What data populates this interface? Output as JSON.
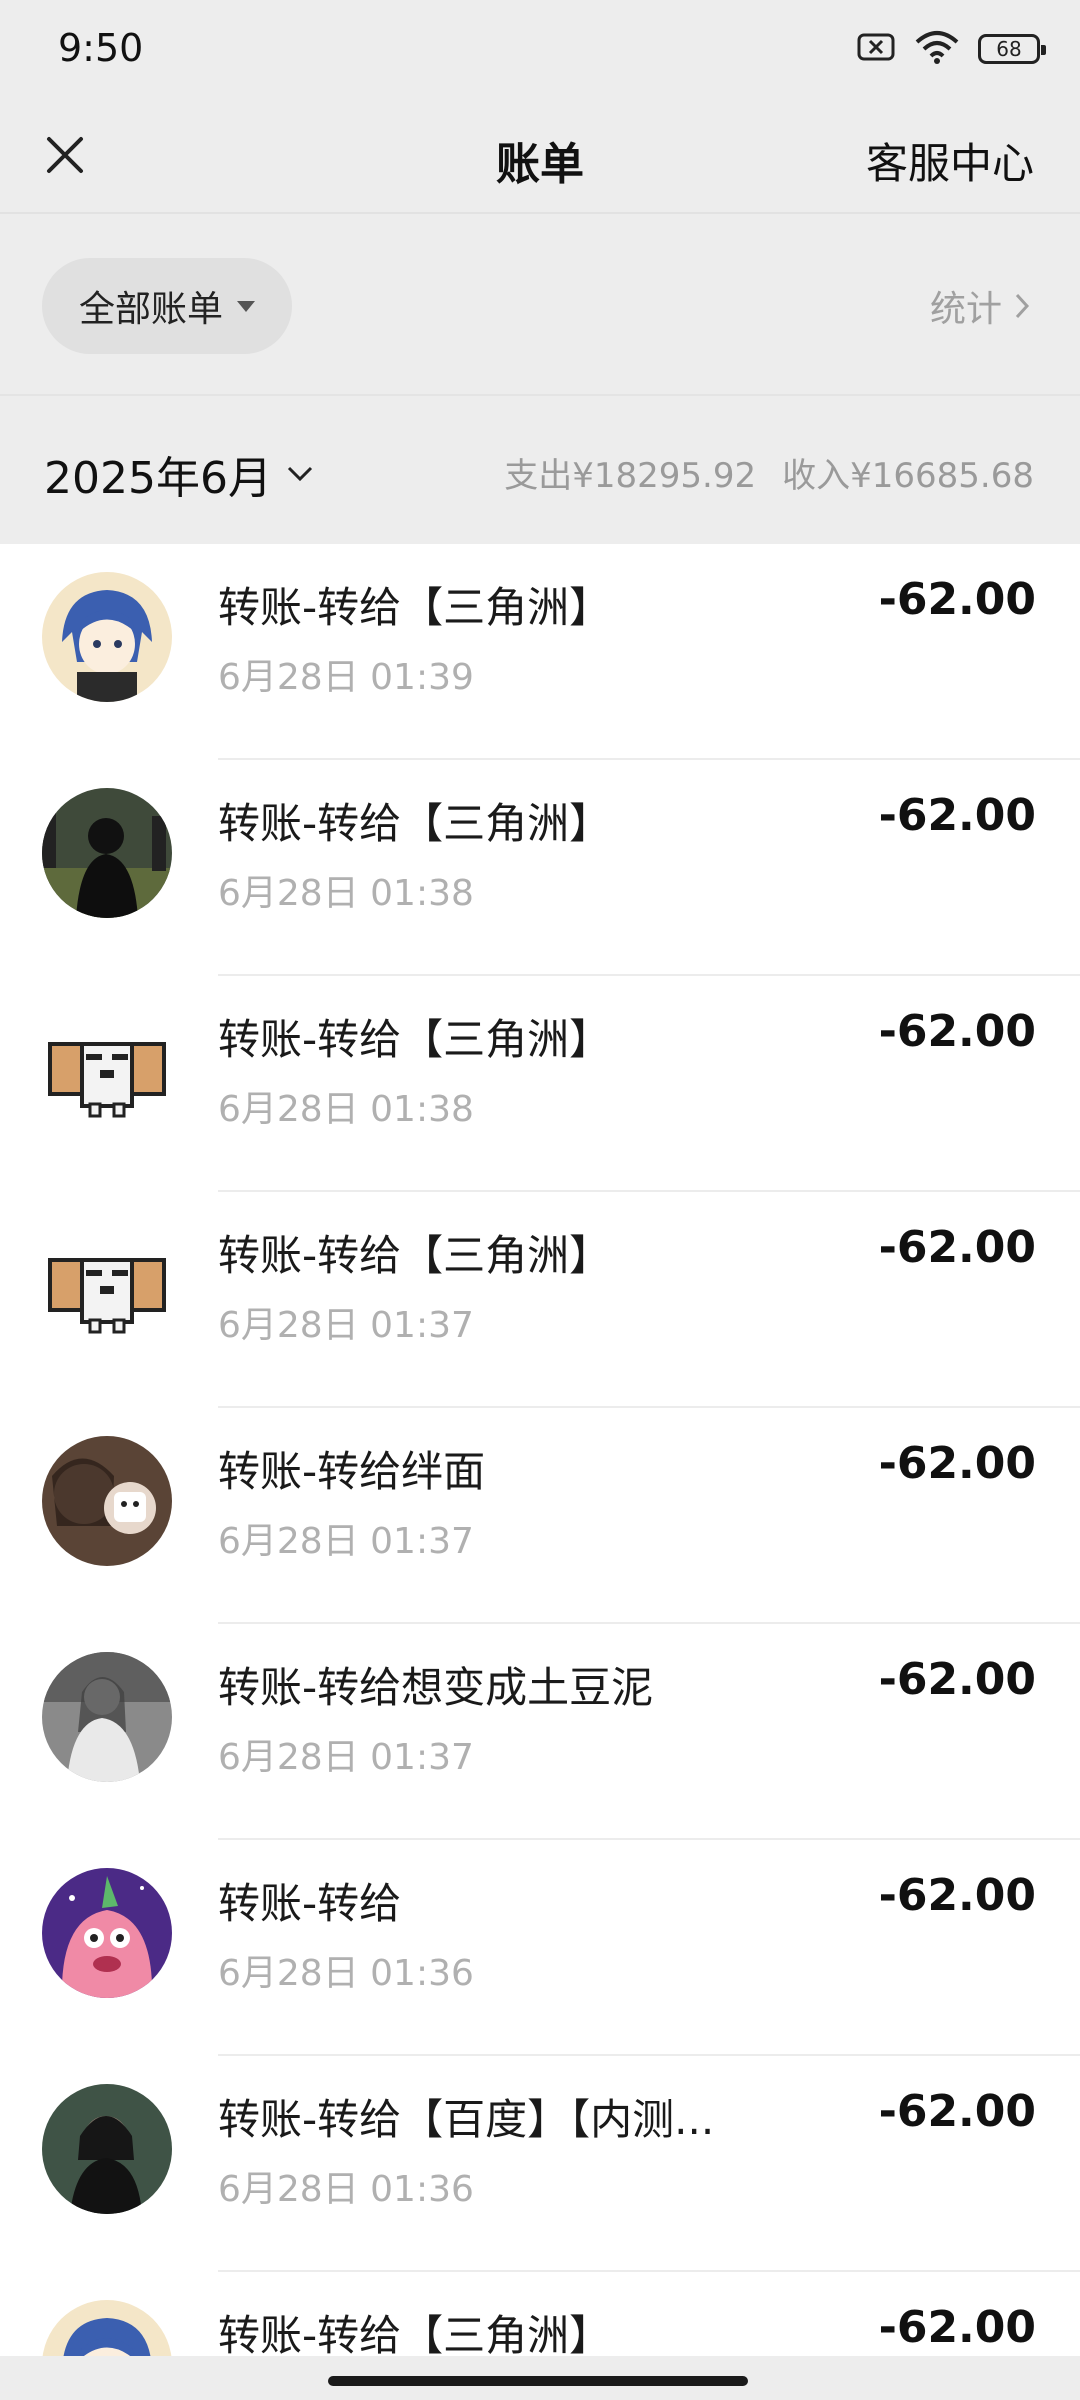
{
  "status": {
    "time": "9:50",
    "battery": "68",
    "icons": [
      "sim-x-icon",
      "wifi-icon",
      "battery-icon"
    ]
  },
  "nav": {
    "title": "账单",
    "service": "客服中心",
    "close_icon": "close-icon"
  },
  "filter": {
    "chip_label": "全部账单",
    "stats_label": "统计"
  },
  "month": {
    "label": "2025年6月",
    "expense": "支出¥18295.92",
    "income": "收入¥16685.68"
  },
  "transactions": [
    {
      "title": "转账-转给【三角洲】",
      "time": "6月28日 01:39",
      "amount": "-62.00",
      "avatar": "anime-girl-avatar"
    },
    {
      "title": "转账-转给【三角洲】",
      "time": "6月28日 01:38",
      "amount": "-62.00",
      "avatar": "silhouette-avatar"
    },
    {
      "title": "转账-转给【三角洲】",
      "time": "6月28日 01:38",
      "amount": "-62.00",
      "avatar": "pixel-dog-avatar"
    },
    {
      "title": "转账-转给【三角洲】",
      "time": "6月28日 01:37",
      "amount": "-62.00",
      "avatar": "pixel-dog-avatar"
    },
    {
      "title": "转账-转给绊面",
      "time": "6月28日 01:37",
      "amount": "-62.00",
      "avatar": "photo-avatar"
    },
    {
      "title": "转账-转给想变成土豆泥",
      "time": "6月28日 01:37",
      "amount": "-62.00",
      "avatar": "grey-photo-avatar"
    },
    {
      "title": "转账-转给",
      "time": "6月28日 01:36",
      "amount": "-62.00",
      "avatar": "cartoon-star-avatar"
    },
    {
      "title": "转账-转给【百度】【内测...",
      "time": "6月28日 01:36",
      "amount": "-62.00",
      "avatar": "dark-photo-avatar"
    },
    {
      "title": "转账-转给【三角洲】",
      "time": "",
      "amount": "-62.00",
      "avatar": "anime-girl-avatar"
    }
  ],
  "colors": {
    "background": "#ededed",
    "list_bg": "#ffffff",
    "muted_text": "#b0b0b0"
  }
}
